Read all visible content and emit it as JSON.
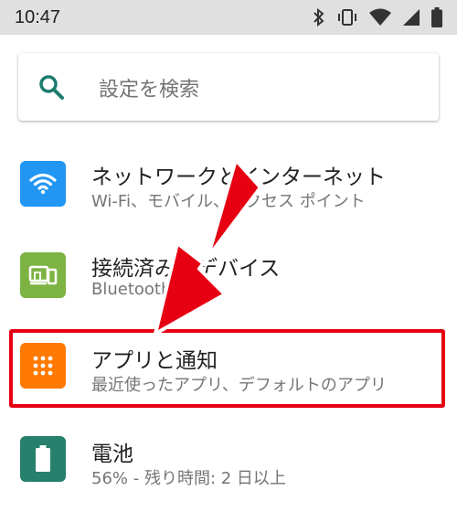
{
  "status_bar": {
    "time": "10:47",
    "icons": [
      "bluetooth-icon",
      "vibrate-icon",
      "wifi-icon",
      "signal-icon",
      "battery-icon"
    ]
  },
  "search": {
    "placeholder": "設定を検索",
    "icon": "search-icon"
  },
  "items": [
    {
      "title": "ネットワークとインターネット",
      "subtitle": "Wi-Fi、モバイル、アクセス ポイント",
      "icon": "wifi-icon",
      "color": "#2196f3"
    },
    {
      "title": "接続済みのデバイス",
      "subtitle": "Bluetooth",
      "icon": "devices-icon",
      "color": "#7cb342"
    },
    {
      "title": "アプリと通知",
      "subtitle": "最近使ったアプリ、デフォルトのアプリ",
      "icon": "apps-grid-icon",
      "color": "#ff7a00"
    },
    {
      "title": "電池",
      "subtitle": "56% - 残り時間: 2 日以上",
      "icon": "battery-icon",
      "color": "#26806d"
    }
  ],
  "annotation": {
    "highlight_color": "#e60012",
    "arrow_color": "#e60012"
  }
}
